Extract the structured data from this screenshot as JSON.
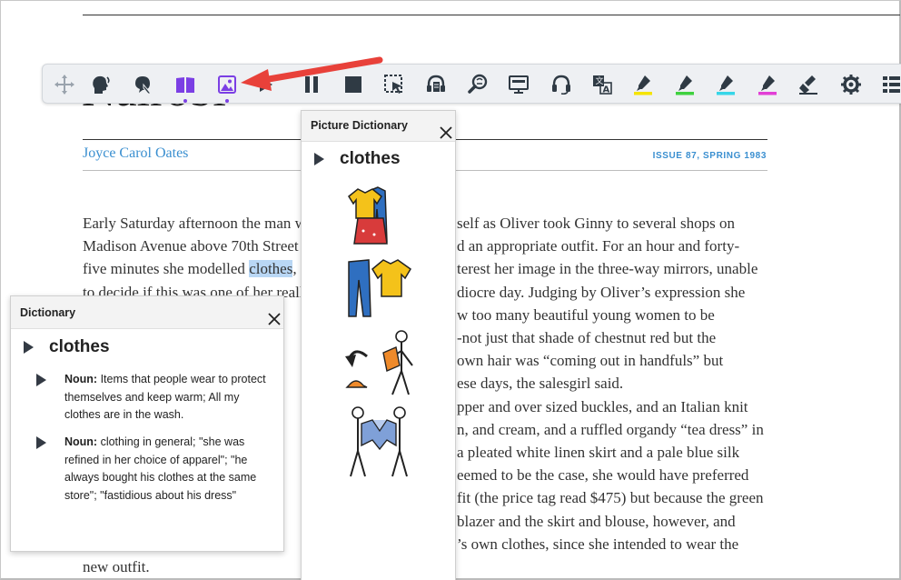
{
  "article": {
    "title": "Nairobi",
    "author": "Joyce Carol Oates",
    "issue": "ISSUE 87, SPRING 1983",
    "lines": [
      [
        "Early Saturday afternoon the man w",
        "",
        "self as Oliver took Ginny to several shops on"
      ],
      [
        "Madison Avenue above 70th Street",
        "",
        "d an appropriate outfit. For an hour and forty-"
      ],
      [
        "five minutes she modelled ",
        "clothes",
        ", ",
        "terest her image in the three-way mirrors, unable"
      ],
      [
        "to decide if this was one of her reall",
        "",
        "diocre day. Judging by Oliver’s expression she"
      ],
      [
        "",
        "",
        "w too many beautiful young women to be"
      ],
      [
        "",
        "",
        "-not just that shade of chestnut red but the"
      ],
      [
        "",
        "",
        " own hair was “coming out in handfuls” but"
      ],
      [
        "",
        "",
        "ese days, the salesgirl said."
      ],
      [
        "",
        "",
        "pper and over sized buckles, and an Italian knit"
      ],
      [
        "",
        "",
        "n, and cream, and a ruffled organdy “tea dress” in"
      ],
      [
        "",
        "",
        " a pleated white linen skirt and a pale blue silk"
      ],
      [
        "",
        "",
        "eemed to be the case, she would have preferred"
      ],
      [
        "",
        "",
        "fit (the price tag read $475) but because the green"
      ],
      [
        "",
        "",
        " blazer and the skirt and blouse, however, and"
      ],
      [
        "",
        "",
        "’s own clothes, since she intended to wear the"
      ],
      [
        "new outfit.",
        "",
        ""
      ]
    ]
  },
  "toolbar": {
    "buttons": [
      {
        "name": "move-handle-icon"
      },
      {
        "name": "speaker-head-icon"
      },
      {
        "name": "hover-speech-icon"
      },
      {
        "name": "dictionary-book-icon",
        "active": true
      },
      {
        "name": "picture-dictionary-icon",
        "active": true
      },
      {
        "name": "play-icon"
      },
      {
        "name": "pause-icon"
      },
      {
        "name": "stop-icon"
      },
      {
        "name": "screenshot-reader-icon"
      },
      {
        "name": "audio-maker-icon"
      },
      {
        "name": "web-search-icon"
      },
      {
        "name": "screen-mask-icon"
      },
      {
        "name": "headphones-icon"
      },
      {
        "name": "translate-icon"
      },
      {
        "name": "highlight-yellow-icon",
        "color": "#f5e400"
      },
      {
        "name": "highlight-green-icon",
        "color": "#3fd13f"
      },
      {
        "name": "highlight-cyan-icon",
        "color": "#36d6e8"
      },
      {
        "name": "highlight-magenta-icon",
        "color": "#e23fd6"
      },
      {
        "name": "clear-highlights-icon"
      },
      {
        "name": "settings-icon"
      },
      {
        "name": "more-menu-icon"
      }
    ]
  },
  "picture_dictionary": {
    "title": "Picture Dictionary",
    "word": "clothes",
    "images": [
      "clothes-pile-icon",
      "jeans-and-shirt-icon",
      "taking-off-clothes-icon",
      "putting-on-jacket-icon"
    ]
  },
  "dictionary": {
    "title": "Dictionary",
    "word": "clothes",
    "definitions": [
      {
        "pos": "Noun:",
        "text": " Items that people wear to protect themselves and keep warm; All my clothes are in the wash."
      },
      {
        "pos": "Noun:",
        "text": " clothing in general; \"she was refined in her choice of apparel\"; \"he always bought his clothes at the same store\"; \"fastidious about his dress\""
      }
    ]
  },
  "colors": {
    "accent_purple": "#7b3fe4",
    "link_blue": "#3a8fd0",
    "arrow_red": "#e8413a",
    "highlight": "#b9d7f5"
  }
}
